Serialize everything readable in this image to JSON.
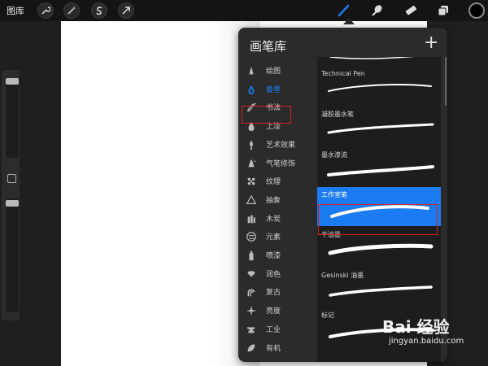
{
  "toolbar": {
    "gallery_label": "图库",
    "left_icons": [
      "wrench-icon",
      "magic-wand-icon",
      "selection-s-icon",
      "transform-arrow-icon"
    ],
    "tools": [
      "brush-icon",
      "smudge-icon",
      "eraser-icon",
      "layers-icon"
    ],
    "active_tool": "brush-icon",
    "accent": "#1a7bf2",
    "current_color": "#000000"
  },
  "panel": {
    "title": "画笔库",
    "add_label": "+",
    "categories": [
      {
        "label": "绘图",
        "icon": "pencil-icon"
      },
      {
        "label": "着墨",
        "icon": "ink-drop-icon",
        "active": true
      },
      {
        "label": "书法",
        "icon": "calligraphy-icon"
      },
      {
        "label": "上漆",
        "icon": "paint-drop-icon"
      },
      {
        "label": "艺术效果",
        "icon": "brush-tip-icon"
      },
      {
        "label": "气笔修饰",
        "icon": "airbrush-icon"
      },
      {
        "label": "纹理",
        "icon": "texture-icon"
      },
      {
        "label": "抽象",
        "icon": "triangle-icon"
      },
      {
        "label": "木炭",
        "icon": "charcoal-icon"
      },
      {
        "label": "元素",
        "icon": "elements-icon"
      },
      {
        "label": "喷漆",
        "icon": "spray-can-icon"
      },
      {
        "label": "润色",
        "icon": "touchup-icon"
      },
      {
        "label": "复古",
        "icon": "retro-icon"
      },
      {
        "label": "亮度",
        "icon": "sparkle-icon"
      },
      {
        "label": "工业",
        "icon": "anvil-icon"
      },
      {
        "label": "有机",
        "icon": "leaf-icon"
      }
    ],
    "brushes": [
      {
        "name": ""
      },
      {
        "name": "Technical Pen"
      },
      {
        "name": "凝胶墨水笔"
      },
      {
        "name": "墨水渗流"
      },
      {
        "name": "工作室笔",
        "selected": true
      },
      {
        "name": "干油墨"
      },
      {
        "name": "Gesinski 油墨"
      },
      {
        "name": "标记"
      }
    ],
    "highlight_color": "#d62020"
  },
  "watermark": {
    "logo": "Bai 经验",
    "url": "jingyan.baidu.com"
  }
}
